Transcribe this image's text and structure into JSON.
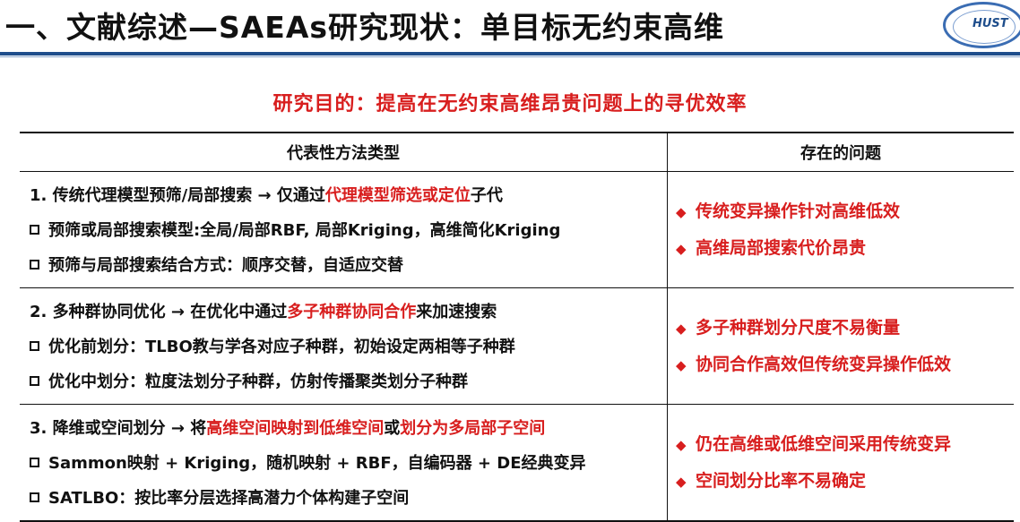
{
  "header": {
    "title": "一、文献综述—SAEAs研究现状：单目标无约束高维",
    "logo_text": "HUST"
  },
  "subtitle": "研究目的：提高在无约束高维昂贵问题上的寻优效率",
  "table": {
    "headers": [
      "代表性方法类型",
      "存在的问题"
    ],
    "rows": [
      {
        "title": {
          "pre": "1. 传统代理模型预筛/局部搜索 → 仅通过",
          "hl": "代理模型筛选或定位",
          "post": "子代"
        },
        "items": [
          "预筛或局部搜索模型:全局/局部RBF, 局部Kriging，高维简化Kriging",
          "预筛与局部搜索结合方式：顺序交替，自适应交替"
        ],
        "issues": [
          "传统变异操作针对高维低效",
          "高维局部搜索代价昂贵"
        ]
      },
      {
        "title": {
          "pre": "2. 多种群协同优化 → 在优化中通过",
          "hl": "多子种群协同合作",
          "post": "来加速搜索"
        },
        "items": [
          "优化前划分：TLBO教与学各对应子种群，初始设定两相等子种群",
          "优化中划分：粒度法划分子种群，仿射传播聚类划分子种群"
        ],
        "issues": [
          "多子种群划分尺度不易衡量",
          "协同合作高效但传统变异操作低效"
        ]
      },
      {
        "title": {
          "pre": "3. 降维或空间划分 → 将",
          "hl": "高维空间映射到低维空间",
          "mid": "或",
          "hl2": "划分为多局部子空间"
        },
        "items": [
          "Sammon映射 + Kriging，随机映射 + RBF，自编码器 + DE经典变异",
          "SATLBO：按比率分层选择高潜力个体构建子空间"
        ],
        "issues": [
          "仍在高维或低维空间采用传统变异",
          "空间划分比率不易确定"
        ]
      }
    ]
  },
  "colors": {
    "accent_red": "#d81e1e",
    "rule_blue": "#1f4e8c"
  },
  "icons": {
    "bullet": "checkbox-square-icon",
    "issue_marker": "diamond-icon"
  }
}
